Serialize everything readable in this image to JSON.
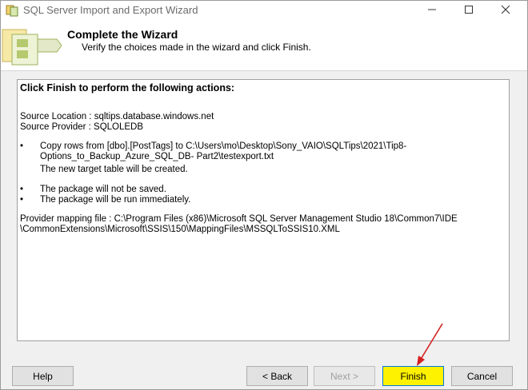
{
  "window": {
    "title": "SQL Server Import and Export Wizard"
  },
  "header": {
    "title": "Complete the Wizard",
    "subtitle": "Verify the choices made in the wizard and click Finish."
  },
  "summary": {
    "heading": "Click Finish to perform the following actions:",
    "source_location": "Source Location : sqltips.database.windows.net",
    "source_provider": "Source Provider : SQLOLEDB",
    "copy_line1": "Copy rows from [dbo].[PostTags] to C:\\Users\\mo\\Desktop\\Sony_VAIO\\SQLTips\\2021\\Tip8-",
    "copy_line2": "Options_to_Backup_Azure_SQL_DB- Part2\\testexport.txt",
    "new_table": "The new target table will be created.",
    "not_saved": "The package will not be saved.",
    "run_now": "The package will be run immediately.",
    "mapping_line1": "Provider mapping file : C:\\Program Files (x86)\\Microsoft SQL Server Management Studio 18\\Common7\\IDE",
    "mapping_line2": "\\CommonExtensions\\Microsoft\\SSIS\\150\\MappingFiles\\MSSQLToSSIS10.XML",
    "bullet_char": "•"
  },
  "buttons": {
    "help": "Help",
    "back": "< Back",
    "next": "Next >",
    "finish": "Finish",
    "cancel": "Cancel"
  },
  "colors": {
    "finish_highlight": "#fff200",
    "annotation_arrow": "#d42020"
  }
}
